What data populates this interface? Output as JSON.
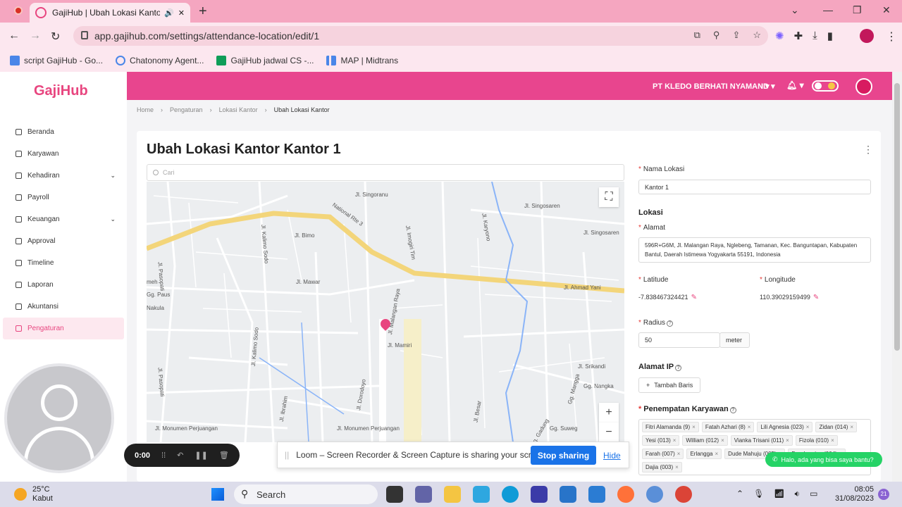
{
  "browser": {
    "tab_title": "GajiHub | Ubah Lokasi Kantor",
    "url": "app.gajihub.com/settings/attendance-location/edit/1",
    "bookmarks": [
      {
        "label": "script GajiHub - Go...",
        "color": "#4a86e8"
      },
      {
        "label": "Chatonomy Agent...",
        "color": "#ffffff"
      },
      {
        "label": "GajiHub jadwal CS -...",
        "color": "#0f9d58"
      },
      {
        "label": "MAP | Midtrans",
        "color": "#4a86e8"
      }
    ]
  },
  "app": {
    "logo": "GajiHub",
    "accent_color": "#e8458e",
    "company": "PT KLEDO BERHATI NYAMAN",
    "language": "ID",
    "menu": [
      {
        "label": "Beranda",
        "has_children": false,
        "active": false
      },
      {
        "label": "Karyawan",
        "has_children": false,
        "active": false
      },
      {
        "label": "Kehadiran",
        "has_children": true,
        "active": false
      },
      {
        "label": "Payroll",
        "has_children": false,
        "active": false
      },
      {
        "label": "Keuangan",
        "has_children": true,
        "active": false
      },
      {
        "label": "Approval",
        "has_children": false,
        "active": false
      },
      {
        "label": "Timeline",
        "has_children": false,
        "active": false
      },
      {
        "label": "Laporan",
        "has_children": false,
        "active": false
      },
      {
        "label": "Akuntansi",
        "has_children": false,
        "active": false
      },
      {
        "label": "Pengaturan",
        "has_children": false,
        "active": true
      }
    ],
    "breadcrumb": [
      "Home",
      "Pengaturan",
      "Lokasi Kantor",
      "Ubah Lokasi Kantor"
    ]
  },
  "page": {
    "title": "Ubah Lokasi Kantor Kantor 1",
    "search_placeholder": "Cari"
  },
  "map": {
    "labels": [
      "National Rte 3",
      "Jl. Singoranu",
      "Jl. Singosaren",
      "Jl. Singosaren",
      "Jl. Karyono",
      "Jl. Bimo",
      "Jl. Imogiri Tim",
      "Jl. Ahmad Yani",
      "Jl. Kalimo Sodo",
      "Jl. Pasopati",
      "Jl. Mawar",
      "Jl. Malangan Raya",
      "Jl. Mamiri",
      "Jl. Kalimo Sodo",
      "Jl. Pasopati",
      "Jl. Srikandi",
      "Gg. Nangka",
      "Gg. Mangga",
      "Jl. Monumen Perjuangan",
      "Jl. Monumen Perjuangan",
      "Jl. Besar",
      "Gg. Suweg",
      "Gg. Gadung",
      "Gg. Paus",
      "Nakula",
      "meh",
      "Jl. Dorodoyo",
      "Jl. Ibrahim"
    ]
  },
  "form": {
    "nama_lokasi_label": "Nama Lokasi",
    "nama_lokasi_value": "Kantor 1",
    "lokasi_title": "Lokasi",
    "alamat_label": "Alamat",
    "alamat_value": "596R+G6M, Jl. Malangan Raya, Nglebeng, Tamanan, Kec. Banguntapan, Kabupaten Bantul, Daerah Istimewa Yogyakarta 55191, Indonesia",
    "latitude_label": "Latitude",
    "latitude_value": "-7.838467324421",
    "longitude_label": "Longitude",
    "longitude_value": "110.39029159499",
    "radius_label": "Radius",
    "radius_value": "50",
    "radius_unit": "meter",
    "alamat_ip_title": "Alamat IP",
    "tambah_baris": "Tambah Baris",
    "penempatan_label": "Penempatan Karyawan",
    "employees": [
      "Fitri Alamanda (9)",
      "Fatah Azhari (8)",
      "Lili Agnesia (023)",
      "Zidan (014)",
      "Yesi (013)",
      "William (012)",
      "Vianka Trisani (011)",
      "Fizola (010)",
      "Farah (007)",
      "Erlangga",
      "Dude Mahuju (005)",
      "Drophamine (004)",
      "Dajia (003)"
    ]
  },
  "loom": {
    "timer": "0:00",
    "share_text": "Loom – Screen Recorder & Screen Capture is sharing your screen.",
    "stop_label": "Stop sharing",
    "hide_label": "Hide"
  },
  "whatsapp_chip": "Halo, ada yang bisa saya bantu?",
  "taskbar": {
    "temperature": "25°C",
    "weather": "Kabut",
    "search": "Search",
    "time": "08:05",
    "date": "31/08/2023",
    "notifications": "21"
  }
}
